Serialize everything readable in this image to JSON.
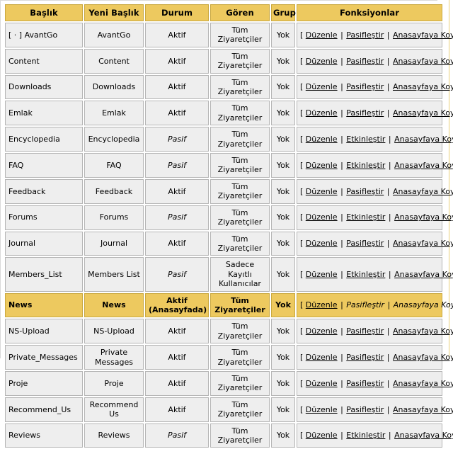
{
  "table": {
    "headers": [
      {
        "key": "title",
        "label": "Başlık"
      },
      {
        "key": "newtitle",
        "label": "Yeni Başlık"
      },
      {
        "key": "status",
        "label": "Durum"
      },
      {
        "key": "viewer",
        "label": "Gören"
      },
      {
        "key": "group",
        "label": "Grup"
      },
      {
        "key": "funcs",
        "label": "Fonksiyonlar"
      }
    ],
    "bracket_open": "[",
    "bracket_close": "]",
    "separator": "|",
    "rows": [
      {
        "title": "[ · ] AvantGo",
        "newtitle": "AvantGo",
        "status": "Aktif",
        "status_italic": false,
        "viewer": "Tüm Ziyaretçiler",
        "group": "Yok",
        "fn1": "Düzenle",
        "fn2": "Pasifleştir",
        "fn3": "Anasayfaya Koy",
        "highlight": false
      },
      {
        "title": "Content",
        "newtitle": "Content",
        "status": "Aktif",
        "status_italic": false,
        "viewer": "Tüm Ziyaretçiler",
        "group": "Yok",
        "fn1": "Düzenle",
        "fn2": "Pasifleştir",
        "fn3": "Anasayfaya Koy",
        "highlight": false
      },
      {
        "title": "Downloads",
        "newtitle": "Downloads",
        "status": "Aktif",
        "status_italic": false,
        "viewer": "Tüm Ziyaretçiler",
        "group": "Yok",
        "fn1": "Düzenle",
        "fn2": "Pasifleştir",
        "fn3": "Anasayfaya Koy",
        "highlight": false
      },
      {
        "title": "Emlak",
        "newtitle": "Emlak",
        "status": "Aktif",
        "status_italic": false,
        "viewer": "Tüm Ziyaretçiler",
        "group": "Yok",
        "fn1": "Düzenle",
        "fn2": "Pasifleştir",
        "fn3": "Anasayfaya Koy",
        "highlight": false
      },
      {
        "title": "Encyclopedia",
        "newtitle": "Encyclopedia",
        "status": "Pasif",
        "status_italic": true,
        "viewer": "Tüm Ziyaretçiler",
        "group": "Yok",
        "fn1": "Düzenle",
        "fn2": "Etkinleştir",
        "fn3": "Anasayfaya Koy",
        "highlight": false
      },
      {
        "title": "FAQ",
        "newtitle": "FAQ",
        "status": "Pasif",
        "status_italic": true,
        "viewer": "Tüm Ziyaretçiler",
        "group": "Yok",
        "fn1": "Düzenle",
        "fn2": "Etkinleştir",
        "fn3": "Anasayfaya Koy",
        "highlight": false
      },
      {
        "title": "Feedback",
        "newtitle": "Feedback",
        "status": "Aktif",
        "status_italic": false,
        "viewer": "Tüm Ziyaretçiler",
        "group": "Yok",
        "fn1": "Düzenle",
        "fn2": "Pasifleştir",
        "fn3": "Anasayfaya Koy",
        "highlight": false
      },
      {
        "title": "Forums",
        "newtitle": "Forums",
        "status": "Pasif",
        "status_italic": true,
        "viewer": "Tüm Ziyaretçiler",
        "group": "Yok",
        "fn1": "Düzenle",
        "fn2": "Etkinleştir",
        "fn3": "Anasayfaya Koy",
        "highlight": false
      },
      {
        "title": "Journal",
        "newtitle": "Journal",
        "status": "Aktif",
        "status_italic": false,
        "viewer": "Tüm Ziyaretçiler",
        "group": "Yok",
        "fn1": "Düzenle",
        "fn2": "Pasifleştir",
        "fn3": "Anasayfaya Koy",
        "highlight": false
      },
      {
        "title": "Members_List",
        "newtitle": "Members List",
        "status": "Pasif",
        "status_italic": true,
        "viewer": "Sadece Kayıtlı Kullanıcılar",
        "group": "Yok",
        "fn1": "Düzenle",
        "fn2": "Etkinleştir",
        "fn3": "Anasayfaya Koy",
        "highlight": false
      },
      {
        "title": "News",
        "newtitle": "News",
        "status": "Aktif (Anasayfada)",
        "status_italic": false,
        "viewer": "Tüm Ziyaretçiler",
        "group": "Yok",
        "fn1": "Düzenle",
        "fn2": "Pasifleştir",
        "fn3": "Anasayfaya Koy",
        "highlight": true
      },
      {
        "title": "NS-Upload",
        "newtitle": "NS-Upload",
        "status": "Aktif",
        "status_italic": false,
        "viewer": "Tüm Ziyaretçiler",
        "group": "Yok",
        "fn1": "Düzenle",
        "fn2": "Pasifleştir",
        "fn3": "Anasayfaya Koy",
        "highlight": false
      },
      {
        "title": "Private_Messages",
        "newtitle": "Private Messages",
        "status": "Aktif",
        "status_italic": false,
        "viewer": "Tüm Ziyaretçiler",
        "group": "Yok",
        "fn1": "Düzenle",
        "fn2": "Pasifleştir",
        "fn3": "Anasayfaya Koy",
        "highlight": false
      },
      {
        "title": "Proje",
        "newtitle": "Proje",
        "status": "Aktif",
        "status_italic": false,
        "viewer": "Tüm Ziyaretçiler",
        "group": "Yok",
        "fn1": "Düzenle",
        "fn2": "Pasifleştir",
        "fn3": "Anasayfaya Koy",
        "highlight": false
      },
      {
        "title": "Recommend_Us",
        "newtitle": "Recommend Us",
        "status": "Aktif",
        "status_italic": false,
        "viewer": "Tüm Ziyaretçiler",
        "group": "Yok",
        "fn1": "Düzenle",
        "fn2": "Pasifleştir",
        "fn3": "Anasayfaya Koy",
        "highlight": false
      },
      {
        "title": "Reviews",
        "newtitle": "Reviews",
        "status": "Pasif",
        "status_italic": true,
        "viewer": "Tüm Ziyaretçiler",
        "group": "Yok",
        "fn1": "Düzenle",
        "fn2": "Etkinleştir",
        "fn3": "Anasayfaya Koy",
        "highlight": false
      }
    ]
  },
  "colors": {
    "header_gold": "#edc95f",
    "header_gold_border": "#c9a83f",
    "cell_gray": "#eeeeee",
    "cell_border": "#b5b5b5",
    "page_rule_gold": "#e8cf7a"
  }
}
